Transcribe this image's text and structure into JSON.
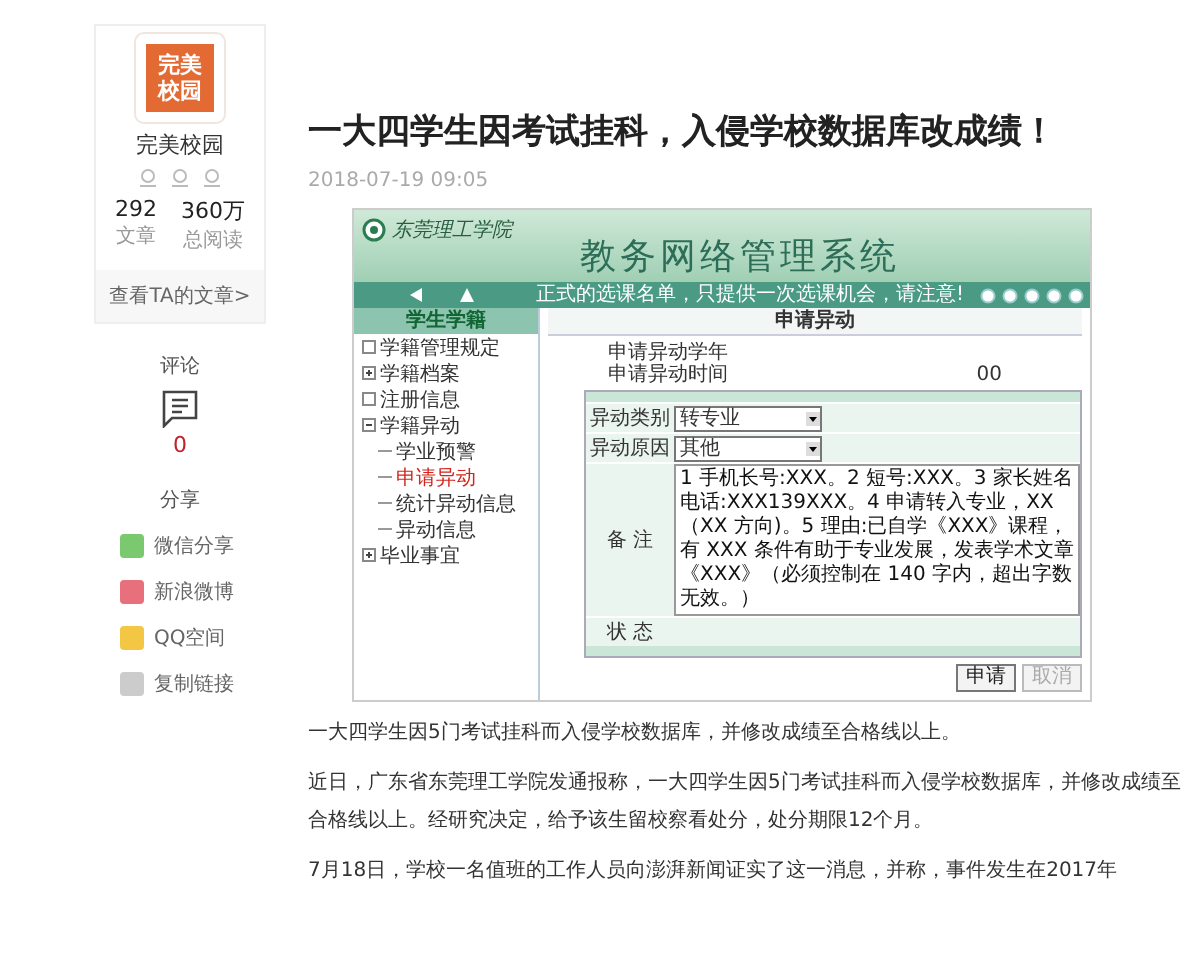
{
  "author": {
    "logo_lines": [
      "完美",
      "校园"
    ],
    "name": "完美校园",
    "stats": [
      {
        "value": "292",
        "label": "文章"
      },
      {
        "value": "360万",
        "label": "总阅读"
      }
    ],
    "link": "查看TA的文章>"
  },
  "comments": {
    "heading": "评论",
    "count": "0"
  },
  "share": {
    "heading": "分享",
    "items": [
      {
        "label": "微信分享",
        "color": "#7bc96f"
      },
      {
        "label": "新浪微博",
        "color": "#e8707d"
      },
      {
        "label": "QQ空间",
        "color": "#f3c643"
      },
      {
        "label": "复制链接",
        "color": "#cccccc"
      }
    ]
  },
  "article": {
    "title": "一大四学生因考试挂科，入侵学校数据库改成绩！",
    "date": "2018-07-19 09:05",
    "screenshot": {
      "school": "东莞理工学院",
      "system_title": "教务网络管理系统",
      "notice": "正式的选课名单，只提供一次选课机会，请注意!",
      "sidebar_title": "学生学籍",
      "tree": [
        {
          "label": "学籍管理规定",
          "kind": "leaf",
          "selected": false
        },
        {
          "label": "学籍档案",
          "kind": "folder",
          "expanded": false,
          "selected": false
        },
        {
          "label": "注册信息",
          "kind": "leaf",
          "selected": false
        },
        {
          "label": "学籍异动",
          "kind": "folder",
          "expanded": true,
          "selected": false,
          "children": [
            {
              "label": "学业预警",
              "selected": false
            },
            {
              "label": "申请异动",
              "selected": true
            },
            {
              "label": "统计异动信息",
              "selected": false
            },
            {
              "label": "异动信息",
              "selected": false
            }
          ]
        },
        {
          "label": "毕业事宜",
          "kind": "folder",
          "expanded": false,
          "selected": false
        }
      ],
      "panel_title": "申请异动",
      "info_lines": [
        "申请异动学年",
        "申请异动时间"
      ],
      "info_value": "00",
      "fields": [
        {
          "label": "异动类别",
          "value": "转专业"
        },
        {
          "label": "异动原因",
          "value": "其他"
        }
      ],
      "remark_label": "备 注",
      "remark": "1 手机长号:XXX。2 短号:XXX。3 家长姓名电话:XXX139XXX。4 申请转入专业，XX（XX 方向)。5 理由:已自学《XXX》课程，有 XXX 条件有助于专业发展，发表学术文章《XXX》（必须控制在 140 字内，超出字数无效。）",
      "status_label": "状 态",
      "buttons": [
        {
          "label": "申请",
          "disabled": false
        },
        {
          "label": "取消",
          "disabled": true
        }
      ]
    },
    "paragraphs": [
      "一大四学生因5门考试挂科而入侵学校数据库，并修改成绩至合格线以上。",
      "近日，广东省东莞理工学院发通报称，一大四学生因5门考试挂科而入侵学校数据库，并修改成绩至合格线以上。经研究决定，给予该生留校察看处分，处分期限12个月。",
      "7月18日，学校一名值班的工作人员向澎湃新闻证实了这一消息，并称，事件发生在2017年"
    ]
  }
}
